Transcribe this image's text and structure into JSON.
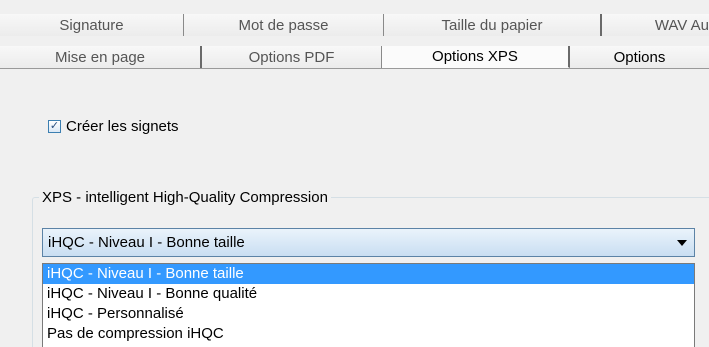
{
  "tabs_back": [
    {
      "label": "Signature"
    },
    {
      "label": "Mot de passe"
    },
    {
      "label": "Taille du papier"
    },
    {
      "label": "WAV Au"
    }
  ],
  "tabs_front": [
    {
      "label": "Mise en page"
    },
    {
      "label": "Options PDF"
    },
    {
      "label": "Options XPS",
      "active": true
    },
    {
      "label": "Options"
    }
  ],
  "bookmarks": {
    "label": "Créer les signets",
    "checked": true
  },
  "compression": {
    "group_title": "XPS - intelligent High-Quality Compression",
    "selected": "iHQC - Niveau I - Bonne taille",
    "options": [
      "iHQC - Niveau I - Bonne taille",
      "iHQC - Niveau I - Bonne qualité",
      "iHQC - Personnalisé",
      "Pas de compression iHQC"
    ]
  }
}
